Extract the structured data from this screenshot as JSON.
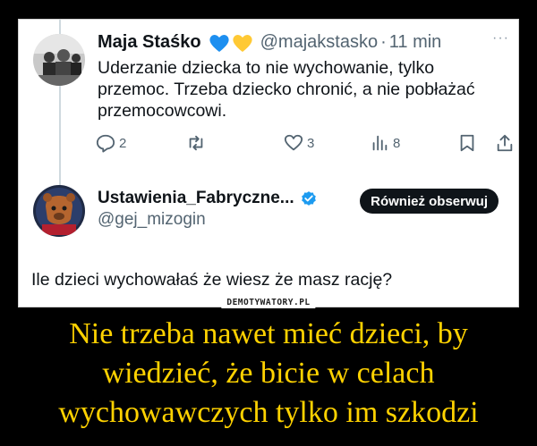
{
  "tweet1": {
    "author_name": "Maja Staśko",
    "hearts": [
      "blue-heart-icon",
      "yellow-heart-icon"
    ],
    "handle": "@majakstasko",
    "separator": "·",
    "time": "11 min",
    "more": "···",
    "text": "Uderzanie dziecka to nie wychowanie, tylko przemoc. Trzeba dziecko chronić, a nie pobłażać przemocowcowi.",
    "actions": {
      "replies": "2",
      "reposts": "",
      "likes": "3",
      "views": "8"
    }
  },
  "tweet2": {
    "author_name": "Ustawienia_Fabryczne...",
    "handle": "@gej_mizogin",
    "follow_button": "Również obserwuj",
    "text": "Ile dzieci wychowałaś że wiesz że masz rację?"
  },
  "watermark": "DEMOTYWATORY.PL",
  "caption": [
    "Nie trzeba nawet mieć dzieci, by",
    "wiedzieć, że bicie w celach",
    "wychowawczych tylko im szkodzi"
  ],
  "colors": {
    "background": "#000000",
    "caption": "#ffd200",
    "verified": "#1d9bf0",
    "blue_heart": "#1d8ff0",
    "yellow_heart": "#ffc934"
  }
}
